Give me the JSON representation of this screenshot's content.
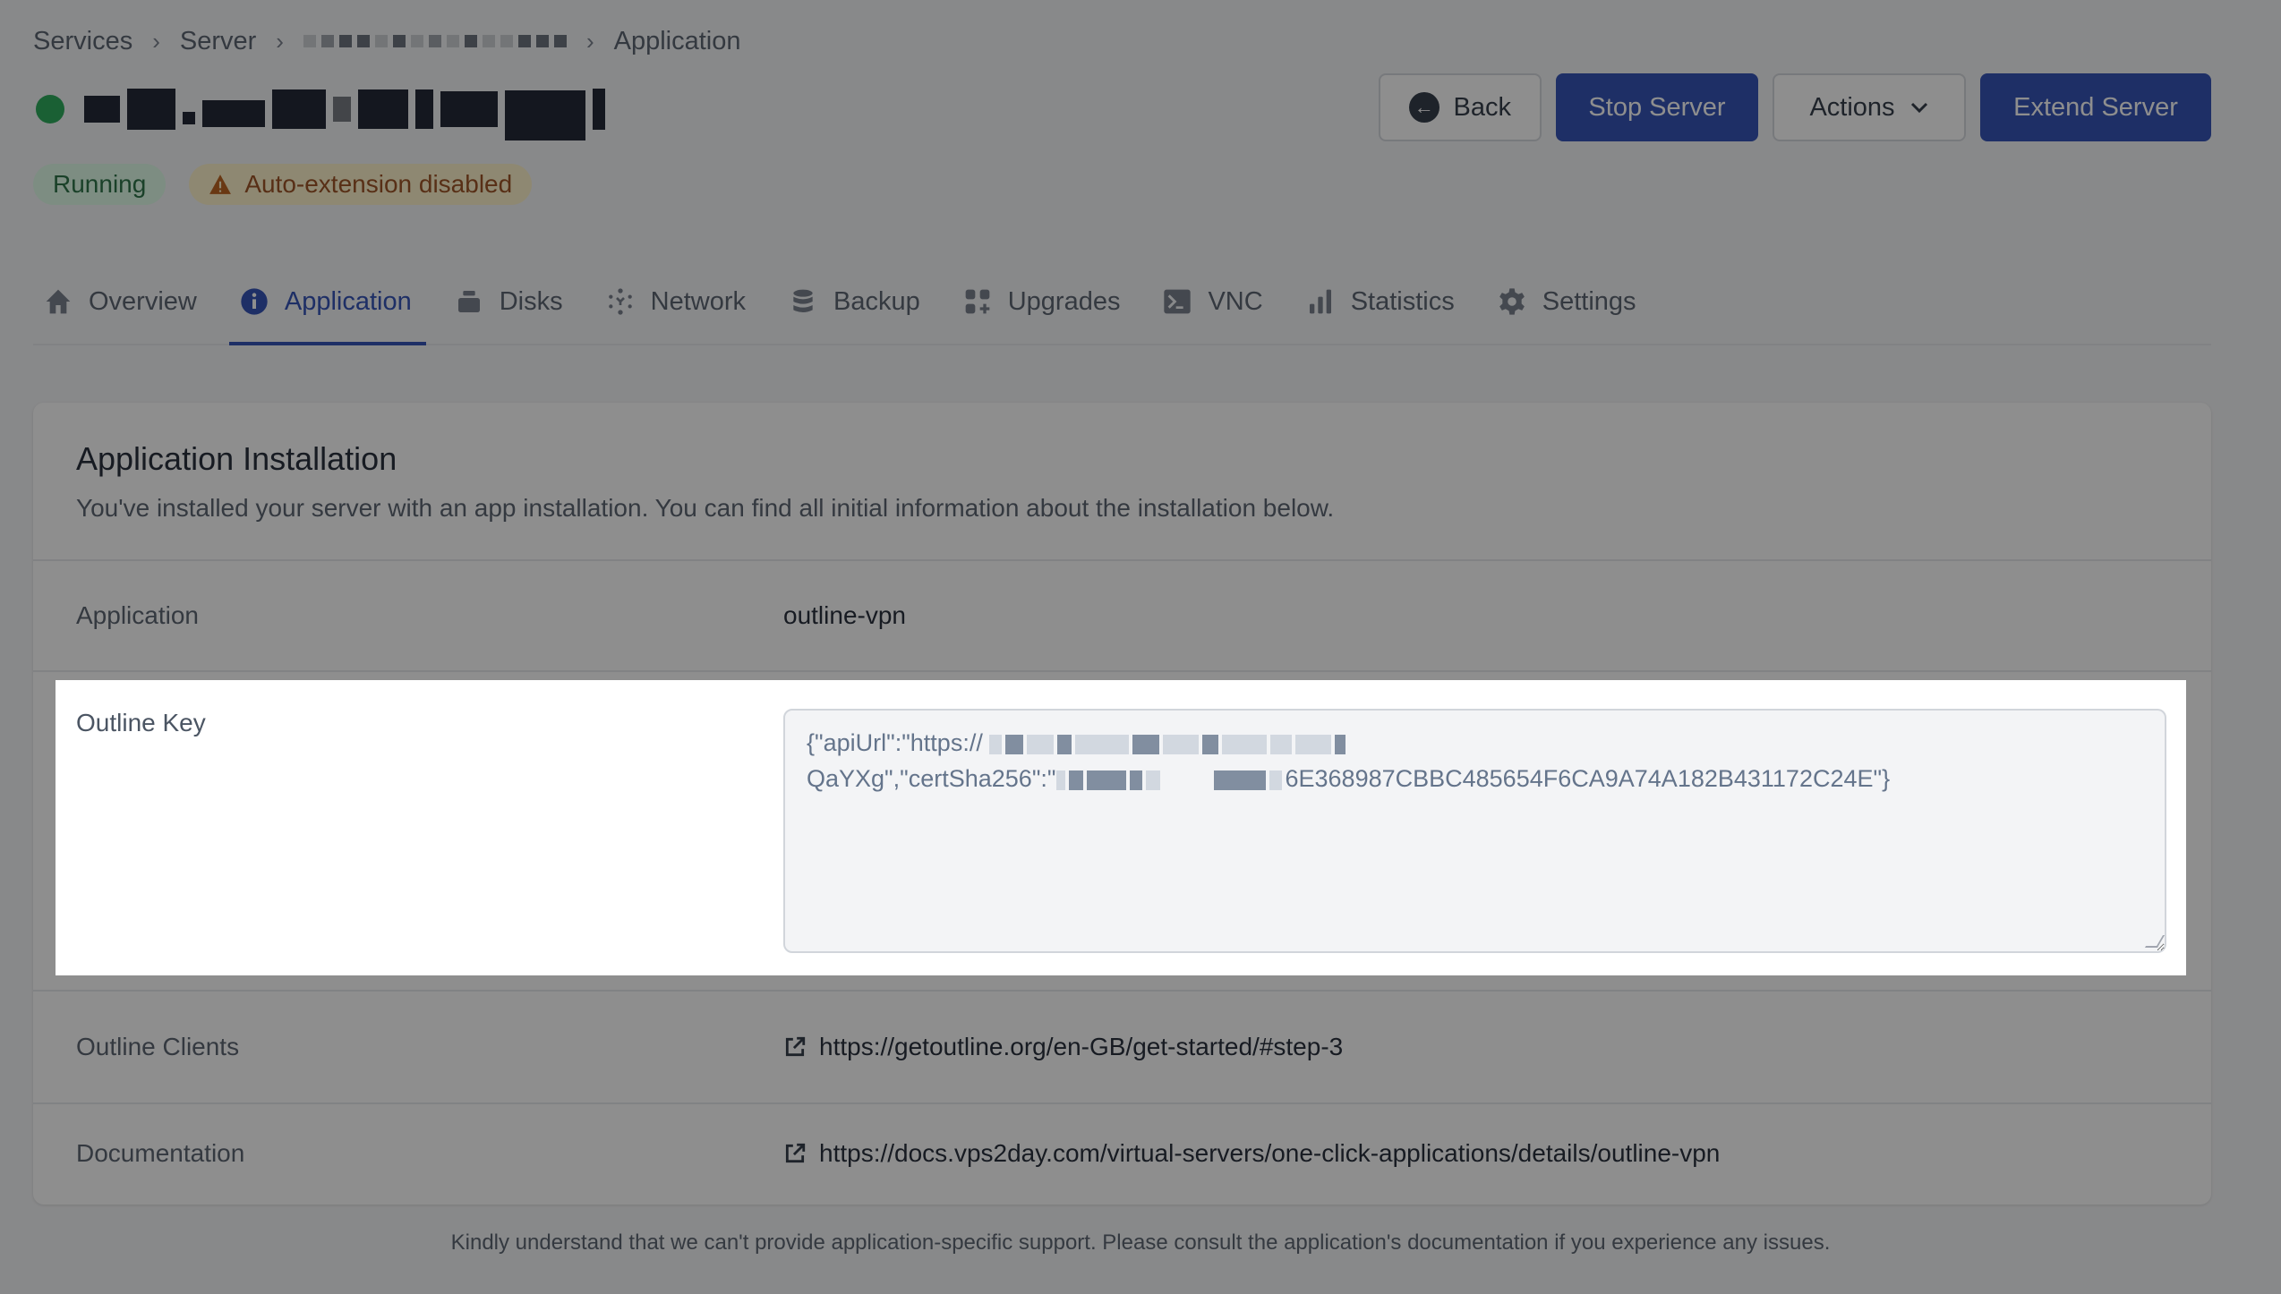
{
  "breadcrumb": {
    "items": [
      "Services",
      "Server",
      "[redacted server name]",
      "Application"
    ],
    "separator": "›"
  },
  "server": {
    "status_color": "#16a34a",
    "name": "[redacted]"
  },
  "badges": {
    "running": "Running",
    "auto_extension": "Auto-extension disabled"
  },
  "header_actions": {
    "back": "Back",
    "stop": "Stop Server",
    "actions": "Actions",
    "extend": "Extend Server"
  },
  "tabs": [
    {
      "label": "Overview",
      "icon": "home-icon"
    },
    {
      "label": "Application",
      "icon": "info-icon",
      "active": true
    },
    {
      "label": "Disks",
      "icon": "disk-icon"
    },
    {
      "label": "Network",
      "icon": "network-icon"
    },
    {
      "label": "Backup",
      "icon": "database-icon"
    },
    {
      "label": "Upgrades",
      "icon": "upgrades-icon"
    },
    {
      "label": "VNC",
      "icon": "terminal-icon"
    },
    {
      "label": "Statistics",
      "icon": "bar-chart-icon"
    },
    {
      "label": "Settings",
      "icon": "gear-icon"
    }
  ],
  "card": {
    "title": "Application Installation",
    "description": "You've installed your server with an app installation. You can find all initial information about the installation below.",
    "rows": {
      "application": {
        "label": "Application",
        "value": "outline-vpn"
      },
      "outline_key": {
        "label": "Outline Key",
        "line1_prefix": "{\"apiUrl\":\"https://",
        "line2_prefix": "QaYXg\",\"certSha256\":\"",
        "line2_suffix": "6E368987CBBC485654F6CA9A74A182B431172C24E\"}"
      },
      "outline_clients": {
        "label": "Outline Clients",
        "value": "https://getoutline.org/en-GB/get-started/#step-3"
      },
      "documentation": {
        "label": "Documentation",
        "value": "https://docs.vps2day.com/virtual-servers/one-click-applications/details/outline-vpn"
      }
    }
  },
  "footer": {
    "note": "Kindly understand that we can't provide application-specific support. Please consult the application's documentation if you experience any issues."
  },
  "colors": {
    "primary": "#1e40af",
    "running_bg": "#dcfce7",
    "running_fg": "#166534",
    "warning_bg": "#fef3c7",
    "warning_fg": "#92400e"
  }
}
